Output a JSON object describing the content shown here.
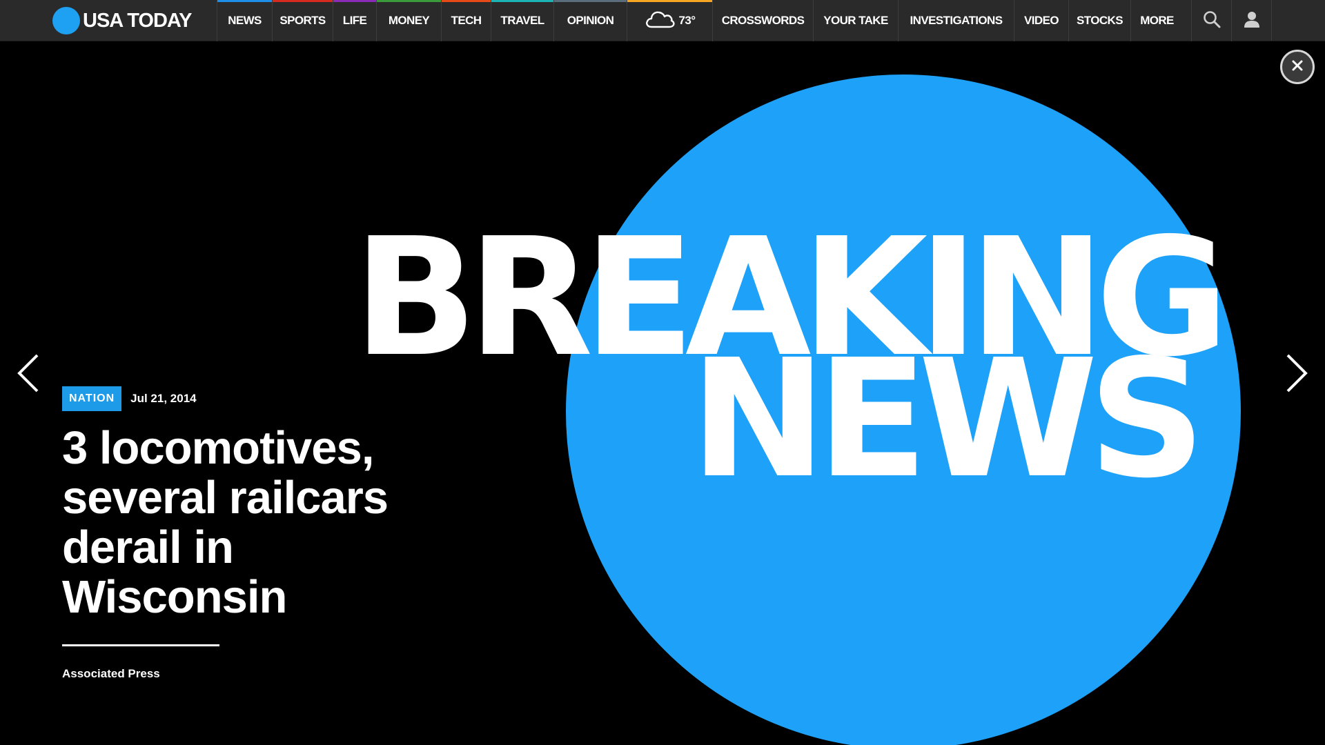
{
  "brand": {
    "name": "USA TODAY",
    "logo_color": "#1ea1f2"
  },
  "nav": {
    "items": [
      {
        "label": "NEWS",
        "accent": "#1e8fe8"
      },
      {
        "label": "SPORTS",
        "accent": "#d52b1e"
      },
      {
        "label": "LIFE",
        "accent": "#8a2bb5"
      },
      {
        "label": "MONEY",
        "accent": "#3a9b3a"
      },
      {
        "label": "TECH",
        "accent": "#e64a19"
      },
      {
        "label": "TRAVEL",
        "accent": "#1bb3b3"
      },
      {
        "label": "OPINION",
        "accent": "#5a6d7c"
      }
    ],
    "weather": {
      "temp": "73°",
      "icon": "cloud-icon",
      "accent": "#f5a623"
    },
    "items_right": [
      {
        "label": "CROSSWORDS"
      },
      {
        "label": "YOUR TAKE"
      },
      {
        "label": "INVESTIGATIONS"
      },
      {
        "label": "VIDEO"
      },
      {
        "label": "STOCKS"
      },
      {
        "label": "MORE"
      }
    ],
    "search_icon": "search-icon",
    "user_icon": "user-icon"
  },
  "hero": {
    "graphic_line1": "BREAKING",
    "graphic_line2": "NEWS",
    "circle_color": "#1ea1f8",
    "close_icon": "close-icon",
    "prev_icon": "chevron-left-icon",
    "next_icon": "chevron-right-icon"
  },
  "story": {
    "section": "NATION",
    "date": "Jul 21, 2014",
    "headline_lines": [
      "3 locomotives,",
      "several railcars",
      "derail in",
      "Wisconsin"
    ],
    "byline": "Associated Press"
  }
}
